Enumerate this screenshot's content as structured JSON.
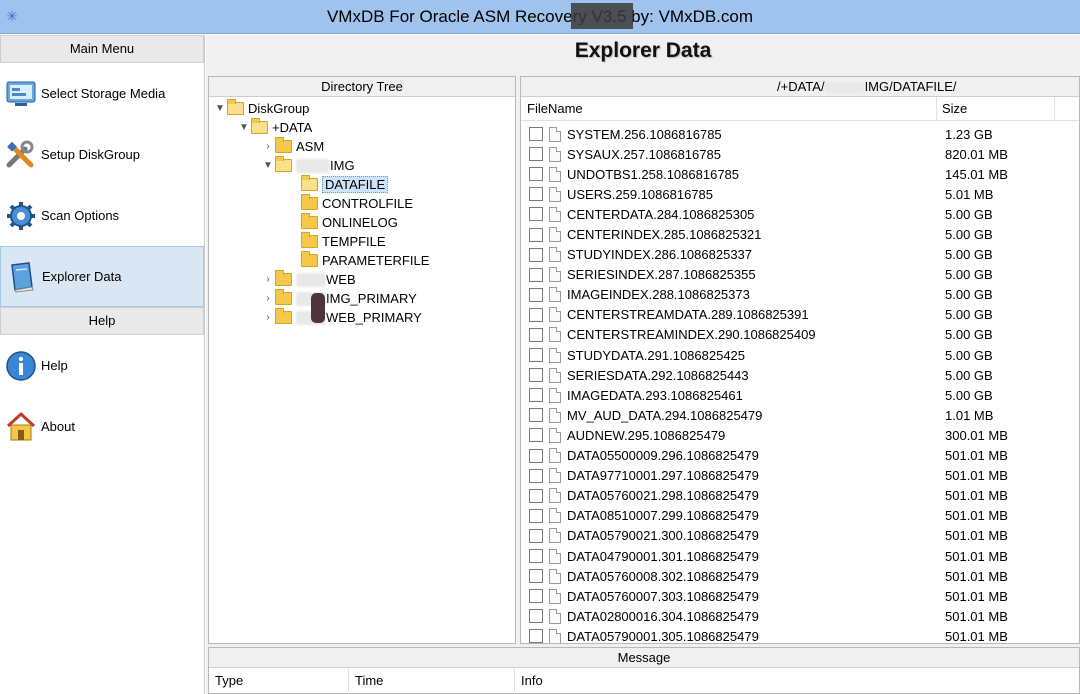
{
  "window": {
    "title": "VMxDB For Oracle ASM Recovery V3.5 by: VMxDB.com"
  },
  "sidebar": {
    "main_menu_header": "Main Menu",
    "main_items": [
      {
        "label": "Select Storage Media",
        "icon": "storage-media-icon"
      },
      {
        "label": "Setup DiskGroup",
        "icon": "tools-icon"
      },
      {
        "label": "Scan Options",
        "icon": "gear-icon"
      },
      {
        "label": "Explorer Data",
        "icon": "explorer-book-icon",
        "selected": true
      }
    ],
    "help_header": "Help",
    "help_items": [
      {
        "label": "Help",
        "icon": "info-icon"
      },
      {
        "label": "About",
        "icon": "home-icon"
      }
    ]
  },
  "main": {
    "title": "Explorer Data",
    "directory_tree": {
      "header": "Directory Tree",
      "nodes": {
        "diskgroup": "DiskGroup",
        "data": "+DATA",
        "asm": "ASM",
        "img": "IMG",
        "datafile": "DATAFILE",
        "controlfile": "CONTROLFILE",
        "onlinelog": "ONLINELOG",
        "tempfile": "TEMPFILE",
        "parameterfile": "PARAMETERFILE",
        "web": "WEB",
        "img_primary": "IMG_PRIMARY",
        "web_primary": "WEB_PRIMARY"
      }
    },
    "file_list": {
      "path_prefix": "/+DATA/",
      "path_suffix": "IMG/DATAFILE/",
      "col_filename": "FileName",
      "col_size": "Size",
      "rows": [
        {
          "name": "SYSTEM.256.1086816785",
          "size": "1.23 GB"
        },
        {
          "name": "SYSAUX.257.1086816785",
          "size": "820.01 MB"
        },
        {
          "name": "UNDOTBS1.258.1086816785",
          "size": "145.01 MB"
        },
        {
          "name": "USERS.259.1086816785",
          "size": "5.01 MB"
        },
        {
          "name": "CENTERDATA.284.1086825305",
          "size": "5.00 GB"
        },
        {
          "name": "CENTERINDEX.285.1086825321",
          "size": "5.00 GB"
        },
        {
          "name": "STUDYINDEX.286.1086825337",
          "size": "5.00 GB"
        },
        {
          "name": "SERIESINDEX.287.1086825355",
          "size": "5.00 GB"
        },
        {
          "name": "IMAGEINDEX.288.1086825373",
          "size": "5.00 GB"
        },
        {
          "name": "CENTERSTREAMDATA.289.1086825391",
          "size": "5.00 GB"
        },
        {
          "name": "CENTERSTREAMINDEX.290.1086825409",
          "size": "5.00 GB"
        },
        {
          "name": "STUDYDATA.291.1086825425",
          "size": "5.00 GB"
        },
        {
          "name": "SERIESDATA.292.1086825443",
          "size": "5.00 GB"
        },
        {
          "name": "IMAGEDATA.293.1086825461",
          "size": "5.00 GB"
        },
        {
          "name": "MV_AUD_DATA.294.1086825479",
          "size": "1.01 MB"
        },
        {
          "name": "AUDNEW.295.1086825479",
          "size": "300.01 MB"
        },
        {
          "name": "DATA05500009.296.1086825479",
          "size": "501.01 MB"
        },
        {
          "name": "DATA97710001.297.1086825479",
          "size": "501.01 MB"
        },
        {
          "name": "DATA05760021.298.1086825479",
          "size": "501.01 MB"
        },
        {
          "name": "DATA08510007.299.1086825479",
          "size": "501.01 MB"
        },
        {
          "name": "DATA05790021.300.1086825479",
          "size": "501.01 MB"
        },
        {
          "name": "DATA04790001.301.1086825479",
          "size": "501.01 MB"
        },
        {
          "name": "DATA05760008.302.1086825479",
          "size": "501.01 MB"
        },
        {
          "name": "DATA05760007.303.1086825479",
          "size": "501.01 MB"
        },
        {
          "name": "DATA02800016.304.1086825479",
          "size": "501.01 MB"
        },
        {
          "name": "DATA05790001.305.1086825479",
          "size": "501.01 MB"
        }
      ]
    },
    "message": {
      "header": "Message",
      "col_type": "Type",
      "col_time": "Time",
      "col_info": "Info"
    }
  }
}
